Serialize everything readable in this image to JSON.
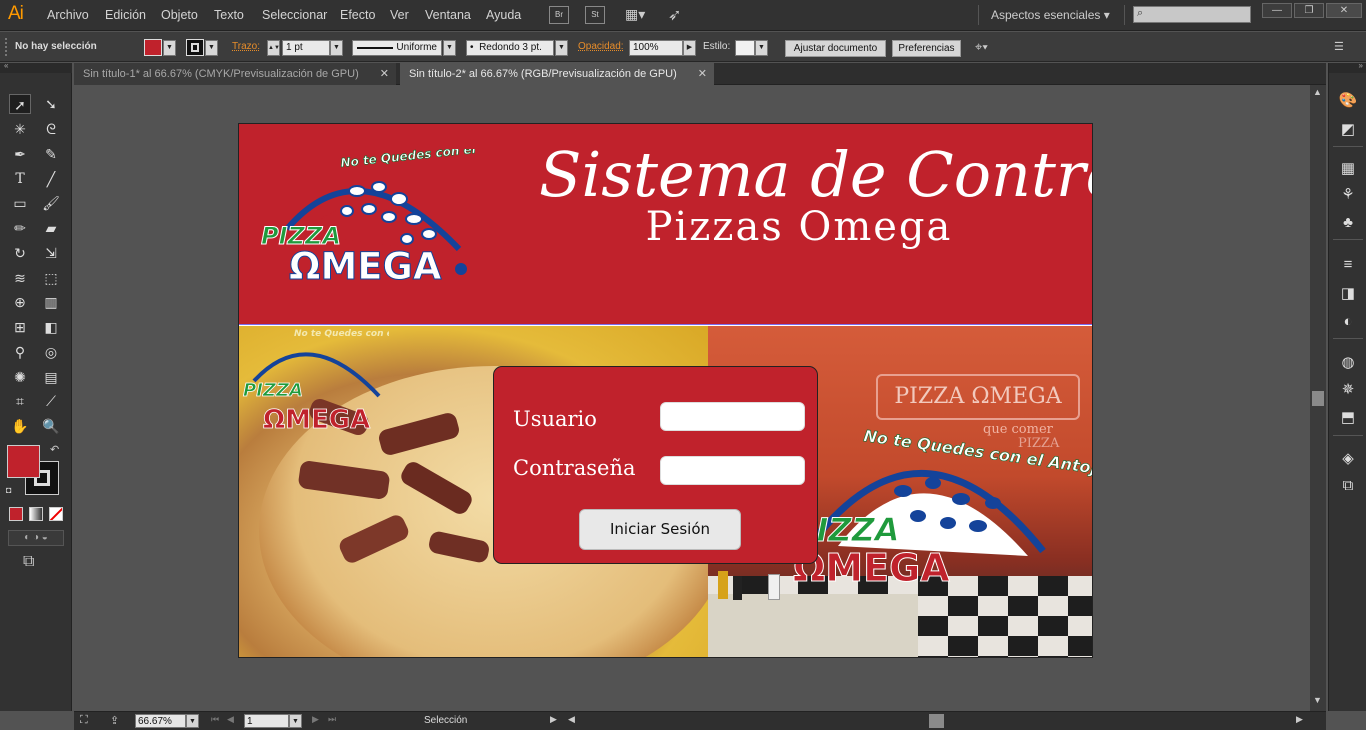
{
  "app": {
    "logo": "Ai"
  },
  "menu": [
    "Archivo",
    "Edición",
    "Objeto",
    "Texto",
    "Seleccionar",
    "Efecto",
    "Ver",
    "Ventana",
    "Ayuda"
  ],
  "menubar_buttons": [
    "Br",
    "St"
  ],
  "workspace": {
    "label": "Aspectos esenciales"
  },
  "window_controls": [
    "—",
    "❐",
    "✕"
  ],
  "control_bar": {
    "selection": "No hay selección",
    "stroke_label": "Trazo:",
    "stroke_weight": "1 pt",
    "profile": "Uniforme",
    "brush": "Redondo 3 pt.",
    "opacity_label": "Opacidad:",
    "opacity": "100%",
    "style_label": "Estilo:",
    "doc_setup": "Ajustar documento",
    "preferences": "Preferencias"
  },
  "tabs": [
    {
      "label": "Sin título-1* al 66.67% (CMYK/Previsualización de GPU)",
      "active": false
    },
    {
      "label": "Sin título-2* al 66.67% (RGB/Previsualización de GPU)",
      "active": true
    }
  ],
  "status": {
    "zoom": "66.67%",
    "page": "1",
    "tool": "Selección"
  },
  "artboard": {
    "title": "Sistema de Control",
    "subtitle": "Pizzas Omega",
    "logo": {
      "slogan": "No te Quedes con el Antojo",
      "pizza": "PIZZA",
      "omega": "ΩMEGA"
    },
    "login": {
      "user_label": "Usuario",
      "user_value": "",
      "password_label": "Contraseña",
      "password_value": "",
      "button": "Iniciar Sesión"
    },
    "right_photo": {
      "sign": "PIZZA ΩMEGA",
      "wall_text": "que comer",
      "wall_text2": "PIZZA",
      "slogan": "No te Quedes con el Antojo",
      "pizza": "PIZZA",
      "omega": "ΩMEGA"
    }
  },
  "colors": {
    "brand_red": "#c0222c",
    "ui_dark": "#323232",
    "canvas": "#535353",
    "accent_orange": "#ff9a00"
  }
}
